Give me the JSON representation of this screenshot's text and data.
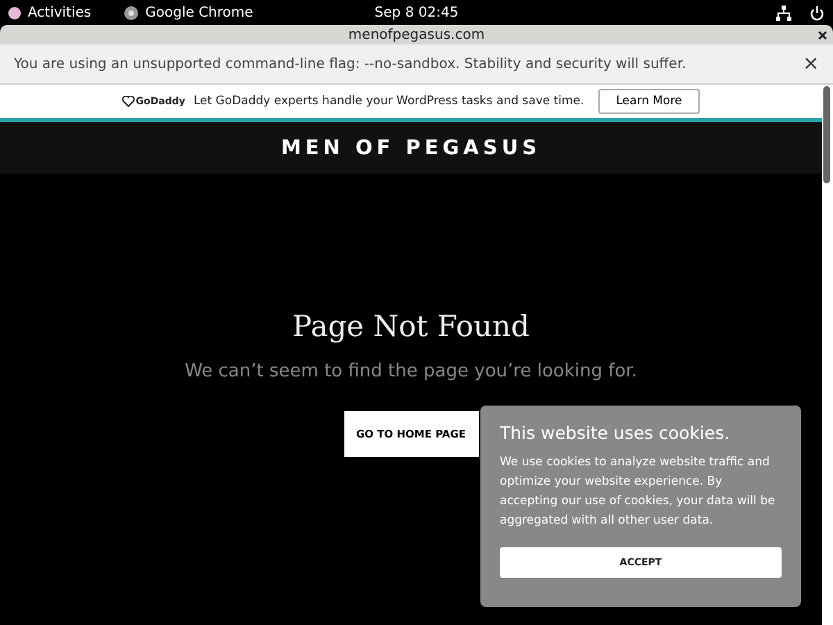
{
  "topbar": {
    "activities": "Activities",
    "app": "Google Chrome",
    "clock": "Sep 8  02:45"
  },
  "window": {
    "title": "menofpegasus.com"
  },
  "infobar": {
    "message": "You are using an unsupported command-line flag: --no-sandbox. Stability and security will suffer.",
    "close": "×"
  },
  "ad": {
    "brand": "GoDaddy",
    "text": "Let GoDaddy experts handle your WordPress tasks and save time.",
    "button": "Learn More"
  },
  "site": {
    "title": "MEN OF PEGASUS"
  },
  "content": {
    "heading": "Page Not Found",
    "message": "We can’t seem to find the page you’re looking for.",
    "button": "GO TO HOME PAGE"
  },
  "cookie": {
    "title": "This website uses cookies.",
    "text": "We use cookies to analyze website traffic and optimize your website experience. By accepting our use of cookies, your data will be aggregated with all other user data.",
    "button": "ACCEPT"
  }
}
